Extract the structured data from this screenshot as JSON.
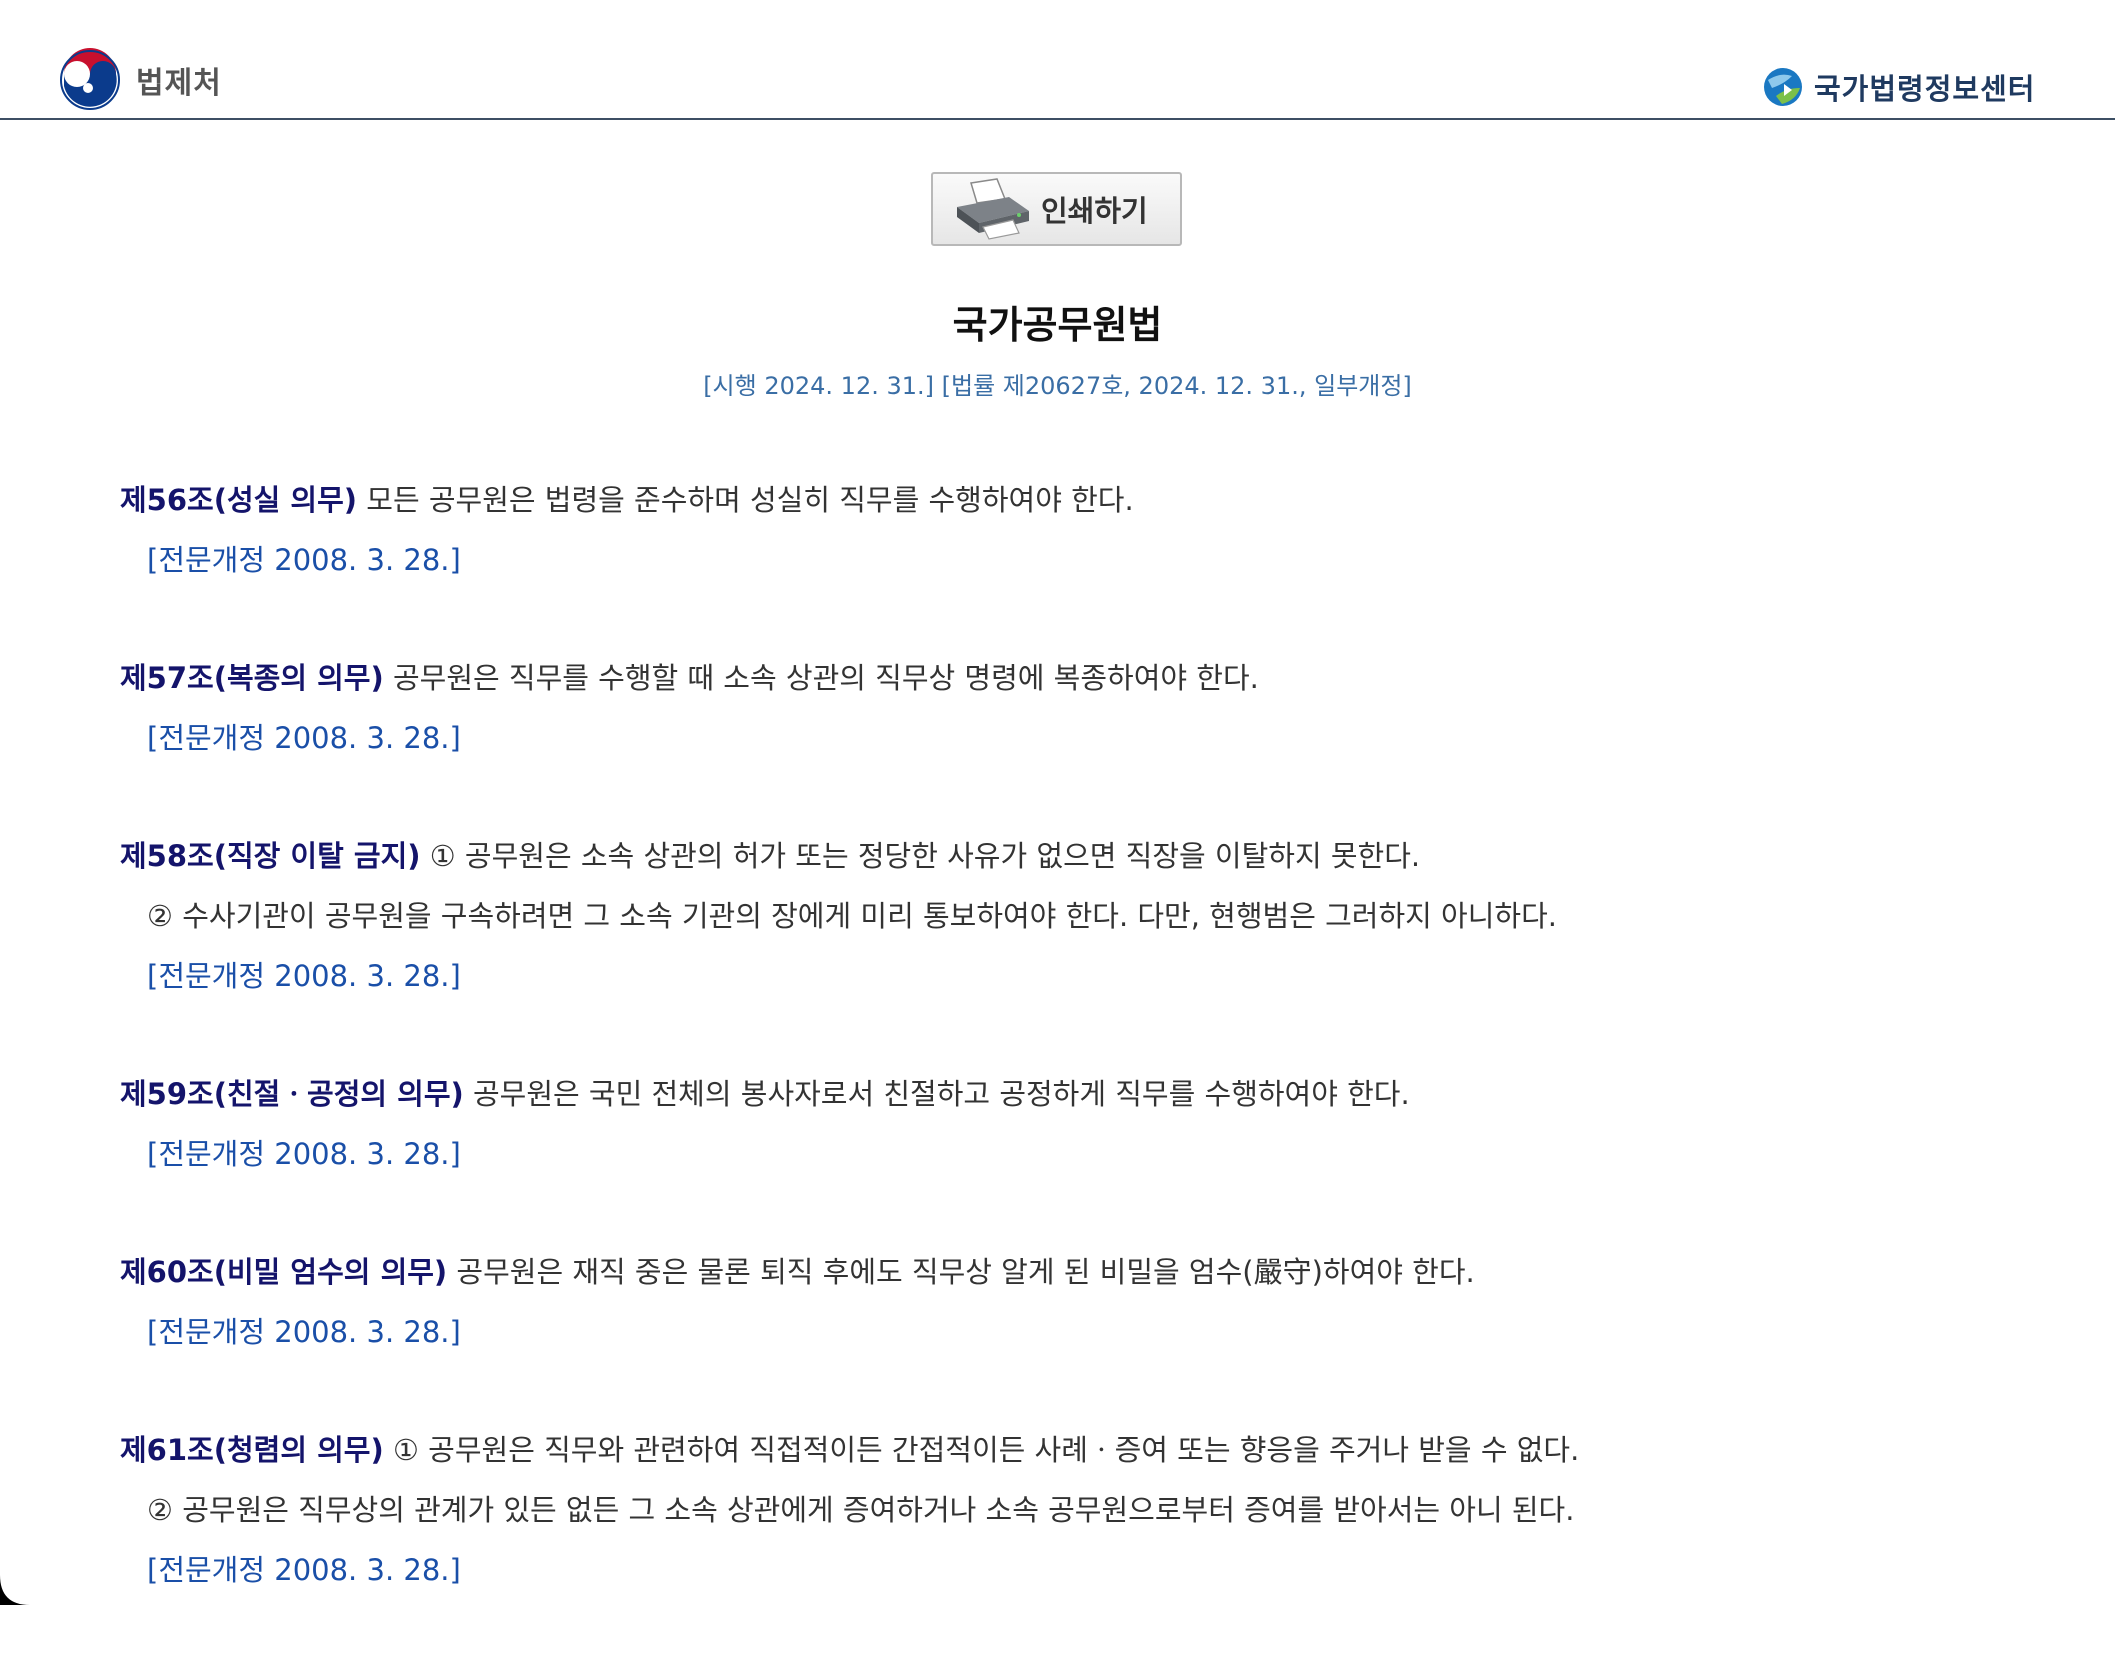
{
  "header": {
    "moleg_name": "법제처",
    "nlic_name": "국가법령정보센터"
  },
  "toolbar": {
    "print_label": "인쇄하기"
  },
  "law": {
    "title": "국가공무원법",
    "info": "[시행 2024. 12. 31.] [법률 제20627호, 2024. 12. 31., 일부개정]"
  },
  "articles": [
    {
      "head": "제56조(성실 의무)",
      "first": "모든 공무원은 법령을 준수하며 성실히 직무를 수행하여야 한다.",
      "amend": "[전문개정 2008. 3. 28.]"
    },
    {
      "head": "제57조(복종의 의무)",
      "first": "공무원은 직무를 수행할 때 소속 상관의 직무상 명령에 복종하여야 한다.",
      "amend": "[전문개정 2008. 3. 28.]"
    },
    {
      "head": "제58조(직장 이탈 금지)",
      "first": "① 공무원은 소속 상관의 허가 또는 정당한 사유가 없으면 직장을 이탈하지 못한다.",
      "second": "② 수사기관이 공무원을 구속하려면 그 소속 기관의 장에게 미리 통보하여야 한다. 다만, 현행범은 그러하지 아니하다.",
      "amend": "[전문개정 2008. 3. 28.]"
    },
    {
      "head": "제59조(친절ㆍ공정의 의무)",
      "first": "공무원은 국민 전체의 봉사자로서 친절하고 공정하게 직무를 수행하여야 한다.",
      "amend": "[전문개정 2008. 3. 28.]"
    },
    {
      "head": "제60조(비밀 엄수의 의무)",
      "first": "공무원은 재직 중은 물론 퇴직 후에도 직무상 알게 된 비밀을 엄수(嚴守)하여야 한다.",
      "amend": "[전문개정 2008. 3. 28.]"
    },
    {
      "head": "제61조(청렴의 의무)",
      "first": "① 공무원은 직무와 관련하여 직접적이든 간접적이든 사례ㆍ증여 또는 향응을 주거나 받을 수 없다.",
      "second": "② 공무원은 직무상의 관계가 있든 없든 그 소속 상관에게 증여하거나 소속 공무원으로부터 증여를 받아서는 아니 된다.",
      "amend": "[전문개정 2008. 3. 28.]"
    }
  ]
}
